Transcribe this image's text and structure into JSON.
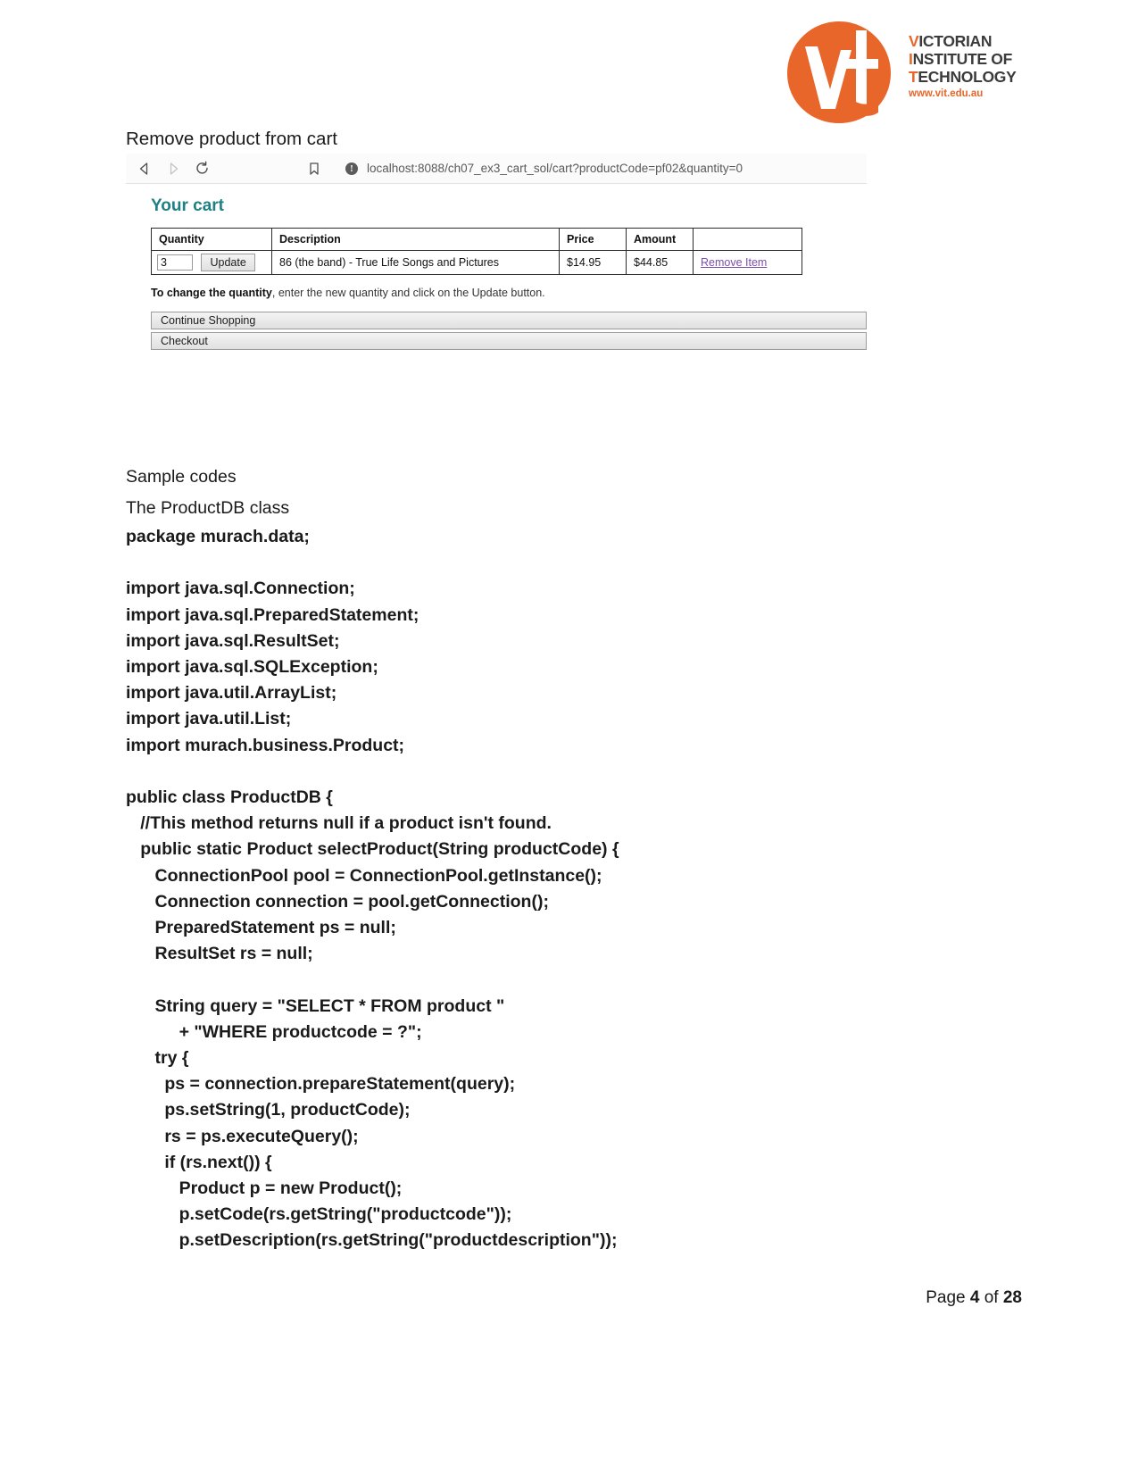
{
  "logo": {
    "line1_hl": "V",
    "line1_rest": "ICTORIAN",
    "line2_hl": "I",
    "line2_rest": "NSTITUTE OF",
    "line3_hl": "T",
    "line3_rest": "ECHNOLOGY",
    "url": "www.vit.edu.au",
    "brand_color": "#e8662a",
    "text_color": "#3b3b3b",
    "mark_alt": "vit-logo-icon"
  },
  "heading": "Remove product from cart",
  "browser": {
    "url": "localhost:8088/ch07_ex3_cart_sol/cart?productCode=pf02&quantity=0",
    "back_icon": "back-arrow-icon",
    "forward_icon": "forward-arrow-icon",
    "reload_icon": "reload-icon",
    "bookmark_icon": "bookmark-icon",
    "info_icon": "info-icon"
  },
  "cart": {
    "title": "Your cart",
    "title_color": "#1f7f83",
    "headers": [
      "Quantity",
      "Description",
      "Price",
      "Amount",
      ""
    ],
    "row": {
      "quantity": "3",
      "update_label": "Update",
      "description": "86 (the band) - True Life Songs and Pictures",
      "price": "$14.95",
      "amount": "$44.85",
      "remove_label": "Remove Item",
      "remove_color": "#7a4ea8"
    },
    "hint_bold": "To change the quantity",
    "hint_rest": ", enter the new quantity and click on the Update button.",
    "continue_label": "Continue Shopping",
    "checkout_label": "Checkout"
  },
  "content": {
    "sample_codes": "Sample codes",
    "class_caption": "The ProductDB class",
    "code_lines": [
      "package murach.data;",
      "",
      "import java.sql.Connection;",
      "import java.sql.PreparedStatement;",
      "import java.sql.ResultSet;",
      "import java.sql.SQLException;",
      "import java.util.ArrayList;",
      "import java.util.List;",
      "import murach.business.Product;",
      "",
      "public class ProductDB {",
      "   //This method returns null if a product isn't found.",
      "   public static Product selectProduct(String productCode) {",
      "      ConnectionPool pool = ConnectionPool.getInstance();",
      "      Connection connection = pool.getConnection();",
      "      PreparedStatement ps = null;",
      "      ResultSet rs = null;",
      "",
      "      String query = \"SELECT * FROM product \"",
      "           + \"WHERE productcode = ?\";",
      "      try {",
      "        ps = connection.prepareStatement(query);",
      "        ps.setString(1, productCode);",
      "        rs = ps.executeQuery();",
      "        if (rs.next()) {",
      "           Product p = new Product();",
      "           p.setCode(rs.getString(\"productcode\"));",
      "           p.setDescription(rs.getString(\"productdescription\"));"
    ]
  },
  "footer": {
    "prefix": "Page ",
    "current": "4",
    "middle": " of ",
    "total": "28"
  }
}
